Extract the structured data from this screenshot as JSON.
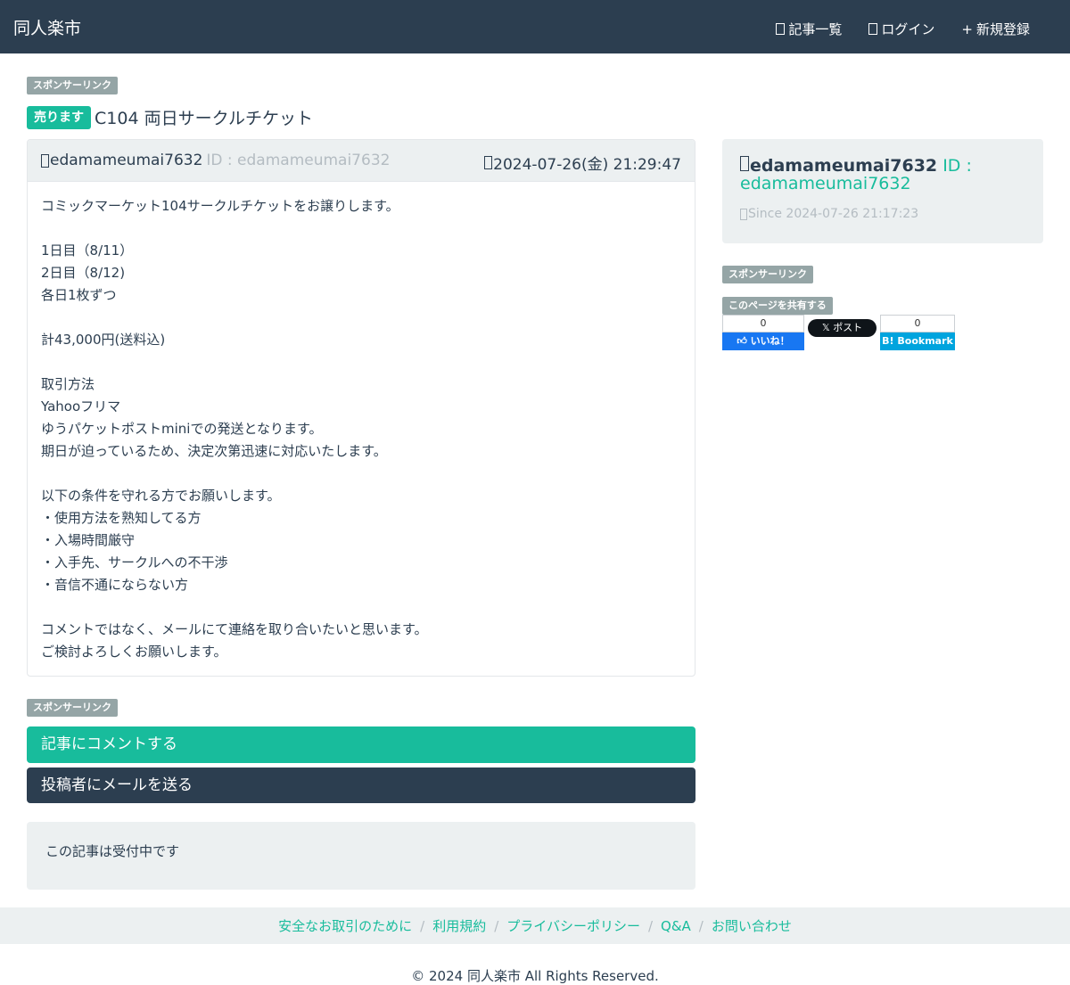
{
  "nav": {
    "brand": "同人楽市",
    "articles_label": "記事一覧",
    "login_label": "ログイン",
    "register_label": "新規登録",
    "register_prefix": "+"
  },
  "sponsor_label": "スポンサーリンク",
  "post": {
    "type_badge": "売ります",
    "title": "C104 両日サークルチケット",
    "author": "edamameumai7632",
    "author_id": "ID : edamameumai7632",
    "date": "2024-07-26(金) 21:29:47",
    "body": "コミックマーケット104サークルチケットをお譲りします。\n\n1日目（8/11）\n2日目（8/12)\n各日1枚ずつ\n\n計43,000円(送料込)\n\n取引方法\nYahooフリマ\nゆうパケットポストminiでの発送となります。\n期日が迫っているため、決定次第迅速に対応いたします。\n\n以下の条件を守れる方でお願いします。\n・使用方法を熟知してる方\n・入場時間厳守\n・入手先、サークルへの不干渉\n・音信不通にならない方\n\nコメントではなく、メールにて連絡を取り合いたいと思います。\nご検討よろしくお願いします。"
  },
  "actions": {
    "comment_label": "記事にコメントする",
    "mail_label": "投稿者にメールを送る"
  },
  "status": "この記事は受付中です",
  "sidebar": {
    "author": "edamameumai7632",
    "author_id": "ID : edamameumai7632",
    "since": "Since 2024-07-26 21:17:23",
    "share_label": "このページを共有する",
    "fb_count": "0",
    "fb_like": "いいね！",
    "x_post": "ポスト",
    "hb_count": "0",
    "hb_label": "Bookmark"
  },
  "footer": {
    "links": [
      "安全なお取引のために",
      "利用規約",
      "プライバシーポリシー",
      "Q&A",
      "お問い合わせ"
    ],
    "copyright": "© 2024 同人楽市 All Rights Reserved."
  },
  "colors": {
    "navbar": "#2c3e50",
    "accent": "#18bc9c",
    "well": "#ecf0f1",
    "muted": "#b4bcc2",
    "sponsor_badge": "#95a5a6"
  }
}
